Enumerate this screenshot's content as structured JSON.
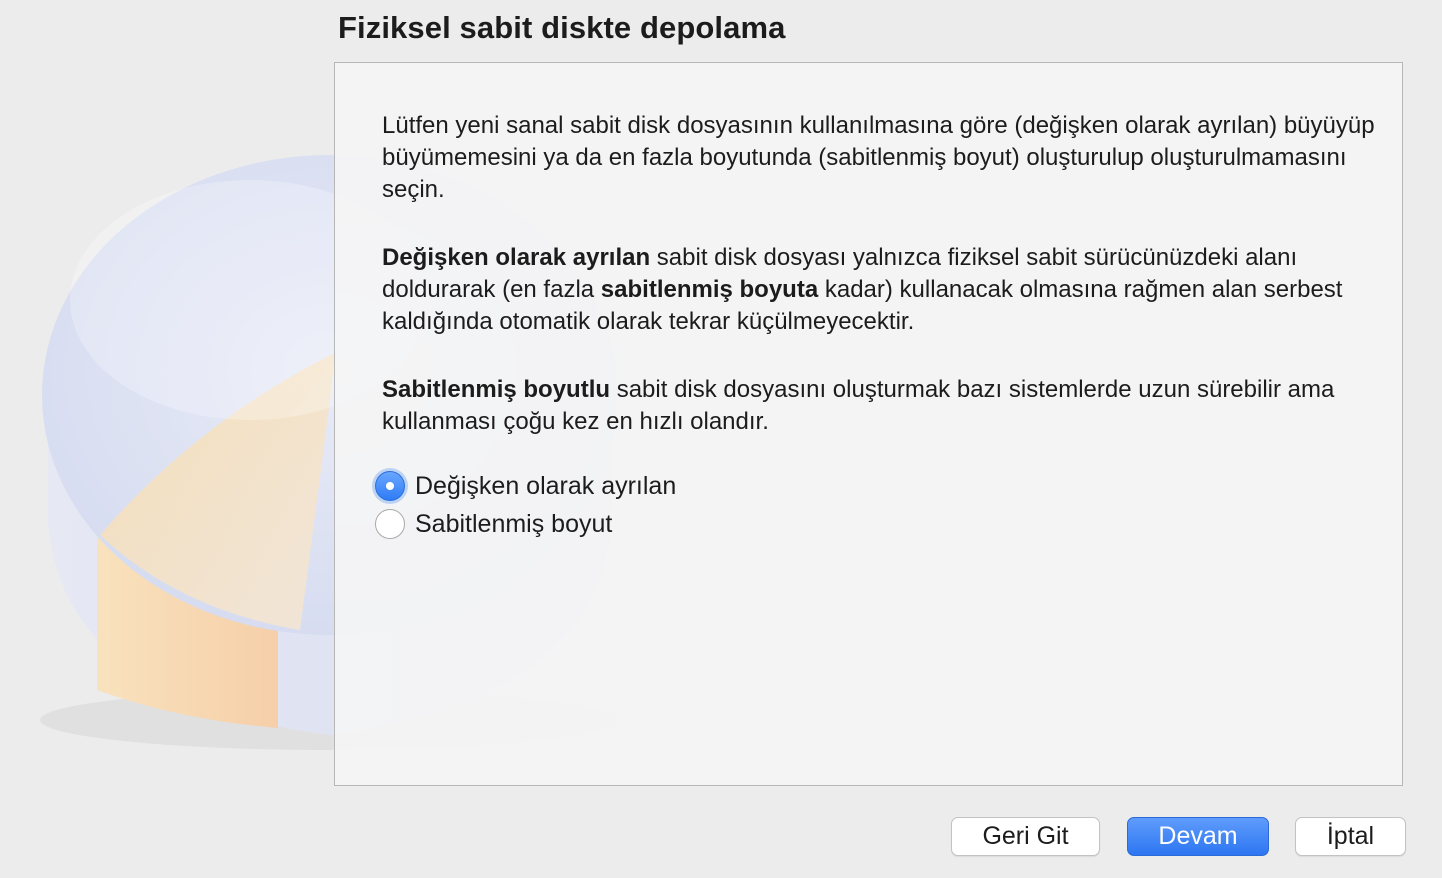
{
  "page": {
    "title": "Fiziksel sabit diskte depolama"
  },
  "description": {
    "para1": "Lütfen yeni sanal sabit disk dosyasının kullanılmasına göre (değişken olarak ayrılan) büyüyüp büyümemesini ya da en fazla boyutunda (sabitlenmiş boyut) oluşturulup oluşturulmamasını seçin.",
    "para2_bold1": "Değişken olarak ayrılan",
    "para2_text1": " sabit disk dosyası yalnızca fiziksel sabit sürücünüzdeki alanı doldurarak (en fazla ",
    "para2_bold2": "sabitlenmiş boyuta",
    "para2_text2": " kadar) kullanacak olmasına rağmen alan serbest kaldığında otomatik olarak tekrar küçülmeyecektir.",
    "para3_bold": "Sabitlenmiş boyutlu",
    "para3_text": " sabit disk dosyasını oluşturmak bazı sistemlerde uzun sürebilir ama kullanması çoğu kez en hızlı olandır."
  },
  "options": [
    {
      "label": "Değişken olarak ayrılan",
      "selected": true
    },
    {
      "label": "Sabitlenmiş boyut",
      "selected": false
    }
  ],
  "buttons": {
    "back": "Geri Git",
    "continue": "Devam",
    "cancel": "İptal"
  },
  "colors": {
    "accent": "#2f7cf6",
    "background": "#ececec"
  }
}
